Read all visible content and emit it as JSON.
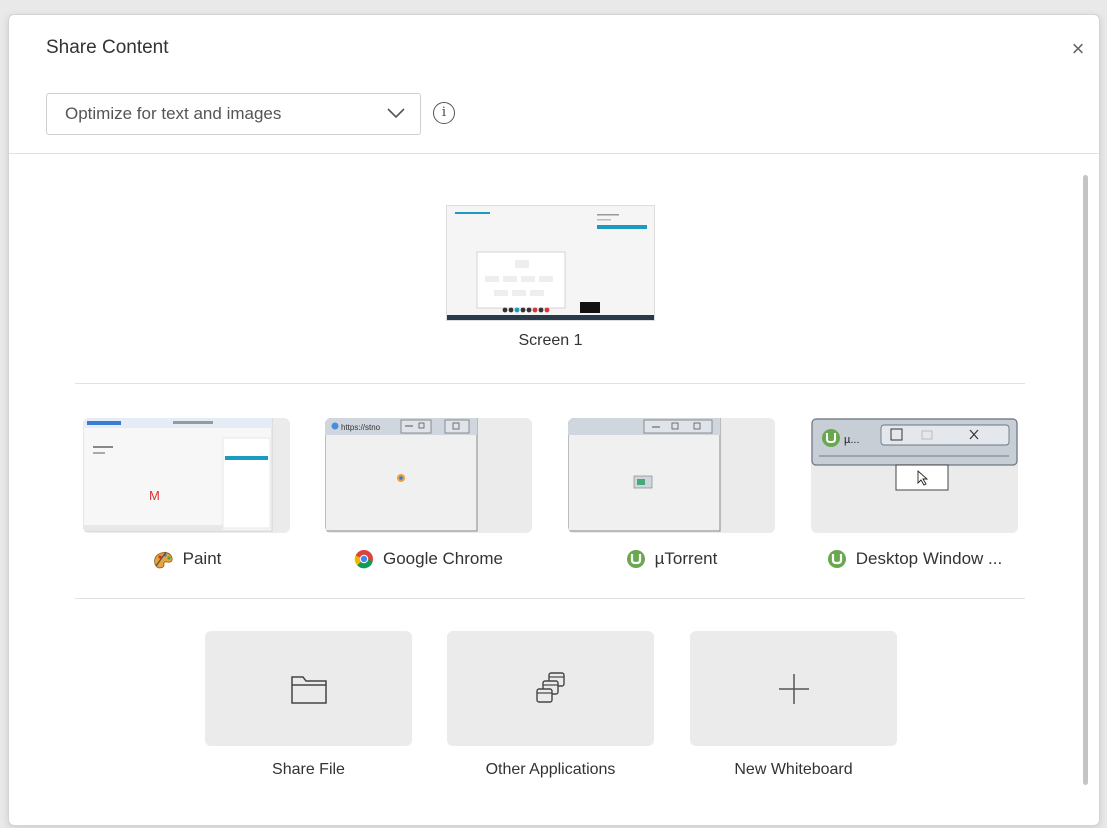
{
  "dialog": {
    "title": "Share Content",
    "close_label": "×",
    "optimize": {
      "selected": "Optimize for text and images"
    },
    "info_label": "i"
  },
  "screen": {
    "label": "Screen 1"
  },
  "windows": [
    {
      "label": "Paint",
      "icon": "paint-icon"
    },
    {
      "label": "Google Chrome",
      "icon": "chrome-icon"
    },
    {
      "label": "µTorrent",
      "icon": "utorrent-icon"
    },
    {
      "label": "Desktop Window ...",
      "icon": "utorrent-icon"
    }
  ],
  "actions": [
    {
      "label": "Share File",
      "icon": "folder-icon"
    },
    {
      "label": "Other Applications",
      "icon": "stacked-windows-icon"
    },
    {
      "label": "New Whiteboard",
      "icon": "plus-icon"
    }
  ],
  "colors": {
    "accent": "#1a9bbf",
    "tile_bg": "#ebebeb",
    "utorrent_green": "#6aa84f"
  }
}
